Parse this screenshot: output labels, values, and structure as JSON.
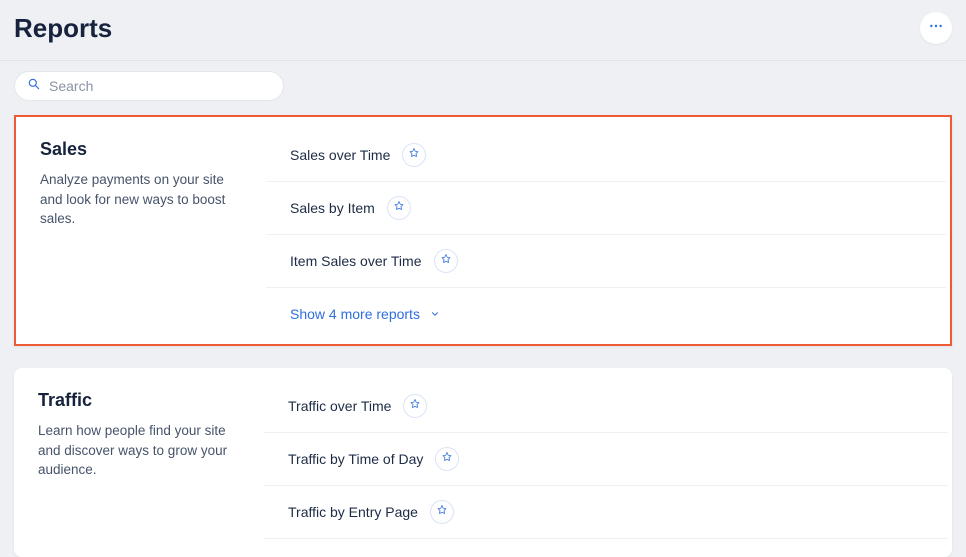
{
  "header": {
    "title": "Reports"
  },
  "search": {
    "placeholder": "Search"
  },
  "sections": [
    {
      "title": "Sales",
      "desc": "Analyze payments on your site and look for new ways to boost sales.",
      "highlighted": true,
      "reports": [
        {
          "name": "Sales over Time"
        },
        {
          "name": "Sales by Item"
        },
        {
          "name": "Item Sales over Time"
        }
      ],
      "show_more": "Show 4 more reports"
    },
    {
      "title": "Traffic",
      "desc": "Learn how people find your site and discover ways to grow your audience.",
      "highlighted": false,
      "reports": [
        {
          "name": "Traffic over Time"
        },
        {
          "name": "Traffic by Time of Day"
        },
        {
          "name": "Traffic by Entry Page"
        }
      ],
      "show_more": ""
    }
  ]
}
